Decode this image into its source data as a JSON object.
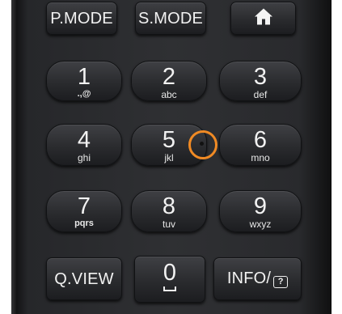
{
  "top_row": {
    "p_mode": "P.MODE",
    "s_mode": "S.MODE"
  },
  "keypad": {
    "k1": {
      "num": "1",
      "sub": ".,@"
    },
    "k2": {
      "num": "2",
      "sub": "abc"
    },
    "k3": {
      "num": "3",
      "sub": "def"
    },
    "k4": {
      "num": "4",
      "sub": "ghi"
    },
    "k5": {
      "num": "5",
      "sub": "jkl"
    },
    "k6": {
      "num": "6",
      "sub": "mno"
    },
    "k7": {
      "num": "7",
      "sub": "pqrs"
    },
    "k8": {
      "num": "8",
      "sub": "tuv"
    },
    "k9": {
      "num": "9",
      "sub": "wxyz"
    },
    "k0": {
      "num": "0"
    }
  },
  "bottom_row": {
    "q_view": "Q.VIEW",
    "info": "INFO/",
    "info_glyph": "?"
  },
  "icons": {
    "home": "home-icon",
    "space": "space-icon",
    "info_box": "question-box-icon"
  },
  "colors": {
    "touch_indicator": "#f08a24",
    "remote_body": "#2f3033",
    "button_text": "#f2f2f2"
  }
}
